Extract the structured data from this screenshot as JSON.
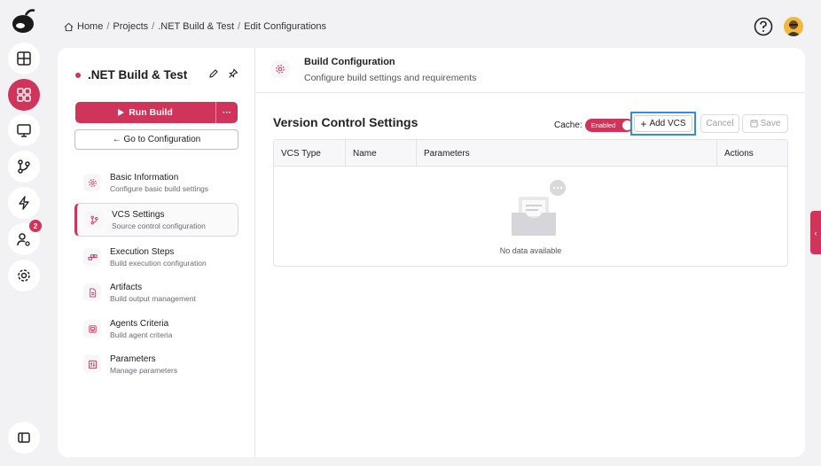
{
  "header": {
    "breadcrumb": [
      "Home",
      "Projects",
      ".NET Build & Test",
      "Edit Configurations"
    ],
    "separator": "/"
  },
  "rail": {
    "items": [
      {
        "name": "dashboard-icon",
        "active": false
      },
      {
        "name": "apps-grid-icon",
        "active": true
      },
      {
        "name": "monitor-icon",
        "active": false
      },
      {
        "name": "git-branch-icon",
        "active": false
      },
      {
        "name": "lightning-icon",
        "active": false
      },
      {
        "name": "user-settings-icon",
        "active": false,
        "badge": "2"
      },
      {
        "name": "settings-gear-icon",
        "active": false
      }
    ]
  },
  "project": {
    "title": ".NET Build & Test",
    "run_label": "Run Build",
    "more_label": "···",
    "goto_label": "← Go to Configuration"
  },
  "nav": [
    {
      "label": "Basic Information",
      "sub": "Configure basic build settings",
      "icon": "gear-icon",
      "active": false
    },
    {
      "label": "VCS Settings",
      "sub": "Source control configuration",
      "icon": "branch-icon",
      "active": true
    },
    {
      "label": "Execution Steps",
      "sub": "Build execution configuration",
      "icon": "steps-icon",
      "active": false
    },
    {
      "label": "Artifacts",
      "sub": "Build output management",
      "icon": "file-icon",
      "active": false
    },
    {
      "label": "Agents Criteria",
      "sub": "Build agent criteria",
      "icon": "agent-icon",
      "active": false
    },
    {
      "label": "Parameters",
      "sub": "Manage parameters",
      "icon": "sliders-icon",
      "active": false
    }
  ],
  "section": {
    "title": "Build Configuration",
    "subtitle": "Configure build settings and requirements"
  },
  "vcs": {
    "title": "Version Control Settings",
    "cache_label": "Cache:",
    "toggle_label": "Enabled",
    "add_label": "Add VCS",
    "cancel_label": "Cancel",
    "save_label": "Save",
    "columns": [
      "VCS Type",
      "Name",
      "Parameters",
      "Actions"
    ],
    "empty_text": "No data available"
  },
  "colors": {
    "accent": "#d0345a",
    "focus": "#2f8fe0"
  }
}
